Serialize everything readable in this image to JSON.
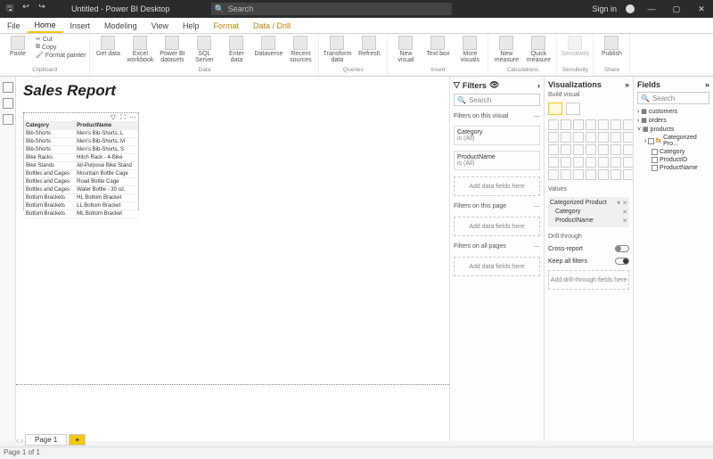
{
  "titlebar": {
    "title": "Untitled - Power BI Desktop",
    "search_placeholder": "Search",
    "signin": "Sign in"
  },
  "tabs": [
    "File",
    "Home",
    "Insert",
    "Modeling",
    "View",
    "Help",
    "Format",
    "Data / Drill"
  ],
  "ribbon": {
    "clipboard": {
      "paste": "Paste",
      "cut": "Cut",
      "copy": "Copy",
      "fmt": "Format painter",
      "label": "Clipboard"
    },
    "data": {
      "get": "Get data",
      "excel": "Excel workbook",
      "pbids": "Power BI datasets",
      "sql": "SQL Server",
      "enter": "Enter data",
      "dv": "Dataverse",
      "recent": "Recent sources",
      "label": "Data"
    },
    "queries": {
      "transform": "Transform data",
      "refresh": "Refresh",
      "label": "Queries"
    },
    "insert": {
      "newv": "New visual",
      "text": "Text box",
      "more": "More visuals",
      "label": "Insert"
    },
    "calc": {
      "newm": "New measure",
      "quick": "Quick measure",
      "label": "Calculations"
    },
    "sens": {
      "sens": "Sensitivity",
      "label": "Sensitivity"
    },
    "share": {
      "pub": "Publish",
      "label": "Share"
    }
  },
  "report": {
    "title": "Sales Report"
  },
  "table": {
    "headers": [
      "Category",
      "ProductName"
    ],
    "rows": [
      [
        "Bib-Shorts",
        "Men's Bib-Shorts, L"
      ],
      [
        "Bib-Shorts",
        "Men's Bib-Shorts, M"
      ],
      [
        "Bib-Shorts",
        "Men's Bib-Shorts, S"
      ],
      [
        "Bike Racks",
        "Hitch Rack - 4-Bike"
      ],
      [
        "Bike Stands",
        "All-Purpose Bike Stand"
      ],
      [
        "Bottles and Cages",
        "Mountain Bottle Cage"
      ],
      [
        "Bottles and Cages",
        "Road Bottle Cage"
      ],
      [
        "Bottles and Cages",
        "Water Bottle - 30 oz."
      ],
      [
        "Bottom Brackets",
        "HL Bottom Bracket"
      ],
      [
        "Bottom Brackets",
        "LL Bottom Bracket"
      ],
      [
        "Bottom Brackets",
        "ML Bottom Bracket"
      ]
    ]
  },
  "filters": {
    "title": "Filters",
    "search": "Search",
    "thisvisual": "Filters on this visual",
    "f1": {
      "name": "Category",
      "val": "is (All)"
    },
    "f2": {
      "name": "ProductName",
      "val": "is (All)"
    },
    "add": "Add data fields here",
    "thispage": "Filters on this page",
    "allpages": "Filters on all pages"
  },
  "viz": {
    "title": "Visualizations",
    "build": "Build visual",
    "values": "Values",
    "well": {
      "main": "Categorized Product",
      "sub1": "Category",
      "sub2": "ProductName"
    },
    "drill": "Drill through",
    "cross": "Cross-report",
    "keep": "Keep all filters",
    "adddrill": "Add drill-through fields here"
  },
  "fields": {
    "title": "Fields",
    "search": "Search",
    "tables": [
      "customers",
      "orders",
      "products"
    ],
    "products": [
      "Categorized Pro…",
      "Category",
      "ProductID",
      "ProductName"
    ]
  },
  "pages": {
    "p1": "Page 1",
    "status": "Page 1 of 1"
  }
}
